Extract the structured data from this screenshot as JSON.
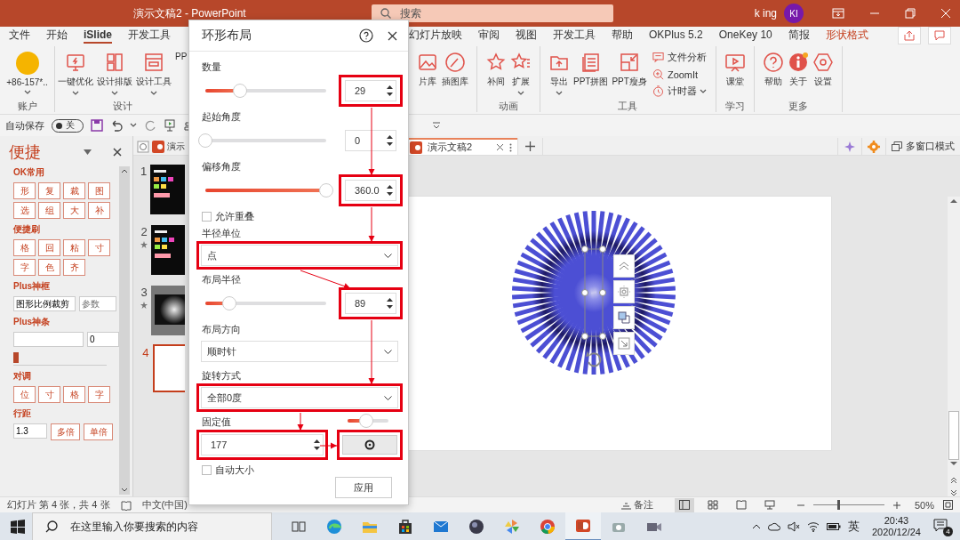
{
  "window": {
    "title": "演示文稿2 - PowerPoint",
    "search_placeholder": "搜索",
    "user": "k ing",
    "user_initials": "KI"
  },
  "ribbon": {
    "tabs_left": [
      {
        "label": "文件",
        "selected": false,
        "kind": "normal"
      },
      {
        "label": "开始",
        "selected": false,
        "kind": "normal"
      },
      {
        "label": "iSlide",
        "selected": true,
        "kind": "normal"
      },
      {
        "label": "开发工具",
        "selected": false,
        "kind": "normal"
      }
    ],
    "tabs_right": [
      {
        "label": "幻灯片放映",
        "selected": false,
        "kind": "normal"
      },
      {
        "label": "审阅",
        "selected": false,
        "kind": "normal"
      },
      {
        "label": "视图",
        "selected": false,
        "kind": "normal"
      },
      {
        "label": "开发工具",
        "selected": false,
        "kind": "normal"
      },
      {
        "label": "帮助",
        "selected": false,
        "kind": "normal"
      },
      {
        "label": "OKPlus 5.2",
        "selected": false,
        "kind": "normal"
      },
      {
        "label": "OneKey 10",
        "selected": false,
        "kind": "normal"
      },
      {
        "label": "简报",
        "selected": false,
        "kind": "normal"
      },
      {
        "label": "形状格式",
        "selected": false,
        "kind": "contextual"
      }
    ],
    "groups_left": [
      {
        "label": "账户",
        "buttons": [
          {
            "label": "+86-157*..",
            "kind": "avatar",
            "dropdown": true
          }
        ]
      },
      {
        "label": "设计",
        "buttons": [
          {
            "label": "一键优化",
            "kind": "large",
            "dropdown": true
          },
          {
            "label": "设计排版",
            "kind": "large",
            "dropdown": true
          },
          {
            "label": "设计工具",
            "kind": "large",
            "dropdown": true
          },
          {
            "label": "PP",
            "kind": "large",
            "dropdown": false
          }
        ]
      }
    ],
    "groups_right": [
      {
        "buttons": [
          {
            "label": "片库",
            "kind": "large",
            "dropdown": false
          },
          {
            "label": "插图库",
            "kind": "large",
            "dropdown": false
          }
        ]
      },
      {
        "label": "动画",
        "buttons": [
          {
            "label": "补间",
            "kind": "large",
            "dropdown": false
          },
          {
            "label": "扩展",
            "kind": "large",
            "dropdown": true
          }
        ]
      },
      {
        "label": "工具",
        "buttons": [
          {
            "label": "导出",
            "kind": "large",
            "dropdown": true
          },
          {
            "label": "PPT拼图",
            "kind": "large",
            "dropdown": false
          },
          {
            "label": "PPT瘦身",
            "kind": "large",
            "dropdown": false
          },
          {
            "label": "文件分析",
            "kind": "small",
            "dropdown": false
          },
          {
            "label": "ZoomIt",
            "kind": "small",
            "dropdown": false
          },
          {
            "label": "计时器",
            "kind": "small",
            "dropdown": true
          }
        ]
      },
      {
        "label": "学习",
        "buttons": [
          {
            "label": "课堂",
            "kind": "large",
            "dropdown": false
          }
        ]
      },
      {
        "label": "更多",
        "buttons": [
          {
            "label": "帮助",
            "kind": "large",
            "dropdown": false
          },
          {
            "label": "关于",
            "kind": "large",
            "dropdown": false
          },
          {
            "label": "设置",
            "kind": "large",
            "dropdown": false
          }
        ]
      }
    ]
  },
  "quick_access": {
    "autosave": "自动保存",
    "autosave_on": false,
    "toggle_text": "关"
  },
  "sidebar": {
    "title": "便捷",
    "sections": [
      {
        "kind": "buttons",
        "label": "OK常用",
        "buttons": [
          "形",
          "复",
          "裁",
          "图",
          "选",
          "组",
          "大",
          "补"
        ]
      },
      {
        "kind": "buttons",
        "label": "便捷刷",
        "buttons": [
          "格",
          "回",
          "粘",
          "寸",
          "字",
          "色",
          "齐"
        ]
      },
      {
        "kind": "fields",
        "label": "Plus神框",
        "fields": [
          {
            "value": "图形比例裁剪"
          },
          {
            "placeholder": "参数"
          }
        ]
      },
      {
        "kind": "slider",
        "label": "Plus神条",
        "fields": [
          {
            "value": "0"
          }
        ],
        "level": 0
      },
      {
        "kind": "buttons",
        "label": "对调",
        "buttons": [
          "位",
          "寸",
          "格",
          "字"
        ]
      },
      {
        "kind": "spacing",
        "label": "行距",
        "fields": [
          {
            "value": "1.3"
          }
        ],
        "buttons": [
          "多倍",
          "单倍"
        ]
      }
    ]
  },
  "slides": [
    {
      "number": "1",
      "starred": false,
      "selected": false,
      "kind": "poster"
    },
    {
      "number": "2",
      "starred": true,
      "selected": false,
      "kind": "poster"
    },
    {
      "number": "3",
      "starred": true,
      "selected": false,
      "kind": "radial"
    },
    {
      "number": "4",
      "starred": false,
      "selected": true,
      "kind": "blank"
    }
  ],
  "doc_tabs": {
    "partial_tab": "演示",
    "tabs": [
      {
        "label": "演示文稿2",
        "selected": true
      }
    ],
    "multi_window": "多窗口模式"
  },
  "dialog": {
    "title": "环形布局",
    "fields": [
      {
        "kind": "slider",
        "label": "数量",
        "level": 0.29,
        "value": "29",
        "highlighted": true
      },
      {
        "kind": "slider",
        "label": "起始角度",
        "level": 0,
        "value": "0",
        "highlighted": false
      },
      {
        "kind": "slider",
        "label": "偏移角度",
        "level": 1,
        "value": "360.0",
        "highlighted": true
      },
      {
        "kind": "checkbox",
        "label": "允许重叠",
        "checked": false
      },
      {
        "kind": "dropdown",
        "label": "半径单位",
        "value": "点",
        "highlighted": true
      },
      {
        "kind": "slider",
        "label": "布局半径",
        "level": 0.2,
        "value": "89",
        "highlighted": true
      },
      {
        "kind": "dropdown",
        "label": "布局方向",
        "value": "顺时针",
        "highlighted": false
      },
      {
        "kind": "dropdown",
        "label": "旋转方式",
        "value": "全部0度",
        "highlighted": true
      },
      {
        "kind": "fixed",
        "label": "固定值",
        "level": 0.45,
        "value": "177",
        "highlighted": true,
        "button_highlighted": true
      },
      {
        "kind": "checkbox",
        "label": "自动大小",
        "checked": false
      }
    ],
    "apply_button": "应用"
  },
  "status_bar": {
    "slide_info": "幻灯片 第 4 张，共 4 张",
    "language": "中文(中国)",
    "notes": "备注",
    "views": [
      {
        "selected": true
      },
      {
        "selected": false
      },
      {
        "selected": false
      },
      {
        "selected": false
      }
    ],
    "zoom_slider": {
      "level": 0.35
    },
    "zoom": "50%"
  },
  "taskbar": {
    "search_placeholder": "在这里输入你要搜索的内容",
    "apps": [
      {
        "selected": false
      },
      {
        "selected": false
      },
      {
        "selected": false
      },
      {
        "selected": false
      },
      {
        "selected": false
      },
      {
        "selected": false
      },
      {
        "selected": false
      },
      {
        "selected": false
      },
      {
        "selected": true
      },
      {
        "selected": false
      },
      {
        "selected": false
      }
    ],
    "ime": "英",
    "time": "20:43",
    "date": "2020/12/24",
    "notifications": "4"
  }
}
